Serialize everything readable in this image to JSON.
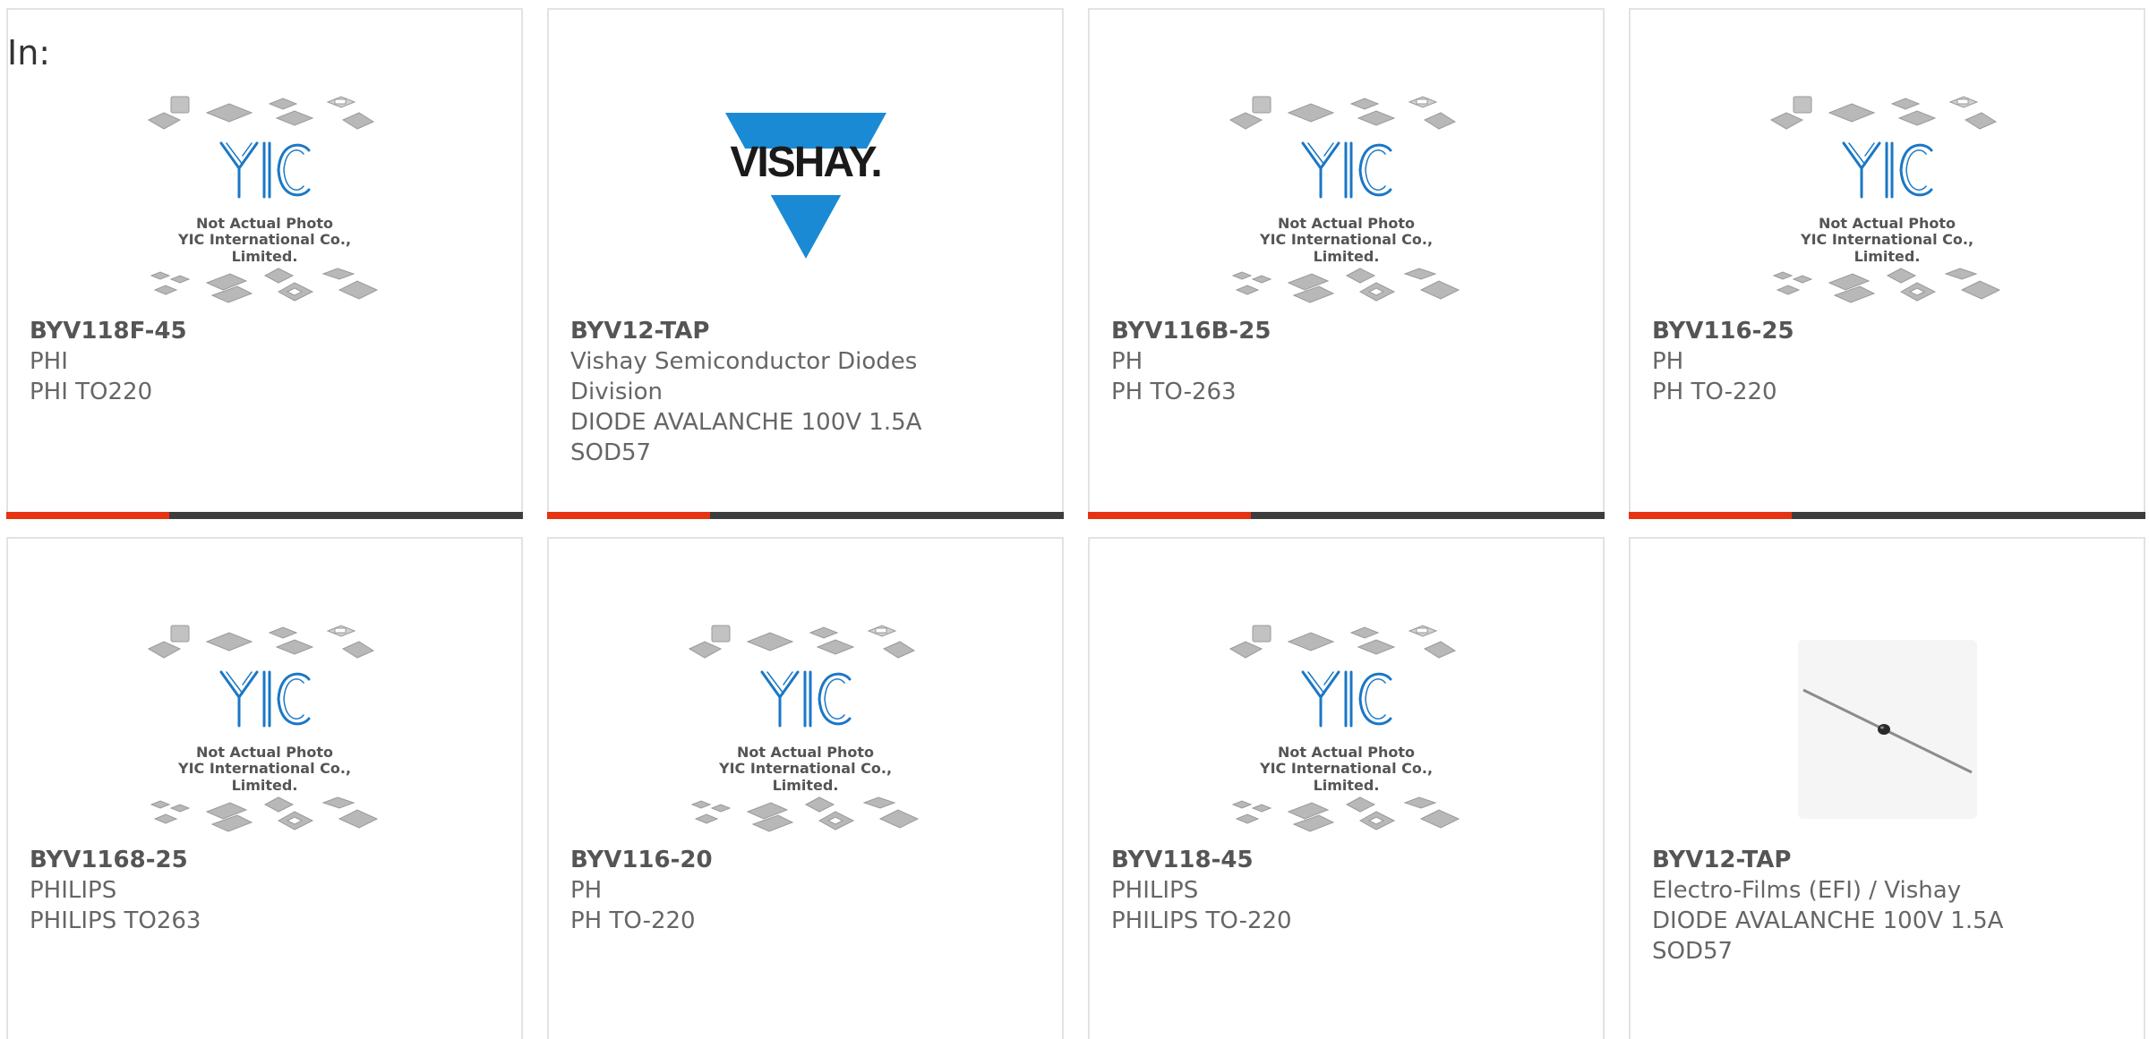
{
  "header": {
    "label": "In:"
  },
  "colors": {
    "accent": "#e63312",
    "bar_dark": "#3d3d3d",
    "yic_blue": "#1b77c5",
    "vishay_blue": "#1b8ad4"
  },
  "placeholder": {
    "line1": "Not Actual Photo",
    "line2": "YIC International Co., Limited."
  },
  "vishay_logo_text": "VISHAY.",
  "products": [
    {
      "part": "BYV118F-45",
      "maker": "PHI",
      "desc": "PHI TO220",
      "image": "yic-placeholder",
      "accent_bar": true
    },
    {
      "part": "BYV12-TAP",
      "maker": "Vishay Semiconductor Diodes Division",
      "desc": "DIODE AVALANCHE 100V 1.5A SOD57",
      "image": "vishay-logo",
      "accent_bar": true
    },
    {
      "part": "BYV116B-25",
      "maker": "PH",
      "desc": "PH TO-263",
      "image": "yic-placeholder",
      "accent_bar": true
    },
    {
      "part": "BYV116-25",
      "maker": "PH",
      "desc": "PH TO-220",
      "image": "yic-placeholder",
      "accent_bar": true
    },
    {
      "part": "BYV1168-25",
      "maker": "PHILIPS",
      "desc": "PHILIPS TO263",
      "image": "yic-placeholder",
      "accent_bar": false
    },
    {
      "part": "BYV116-20",
      "maker": "PH",
      "desc": "PH TO-220",
      "image": "yic-placeholder",
      "accent_bar": false
    },
    {
      "part": "BYV118-45",
      "maker": "PHILIPS",
      "desc": "PHILIPS TO-220",
      "image": "yic-placeholder",
      "accent_bar": false
    },
    {
      "part": "BYV12-TAP",
      "maker": "Electro-Films (EFI) / Vishay",
      "desc": "DIODE AVALANCHE 100V 1.5A SOD57",
      "image": "axial-diode-photo",
      "accent_bar": false
    }
  ]
}
